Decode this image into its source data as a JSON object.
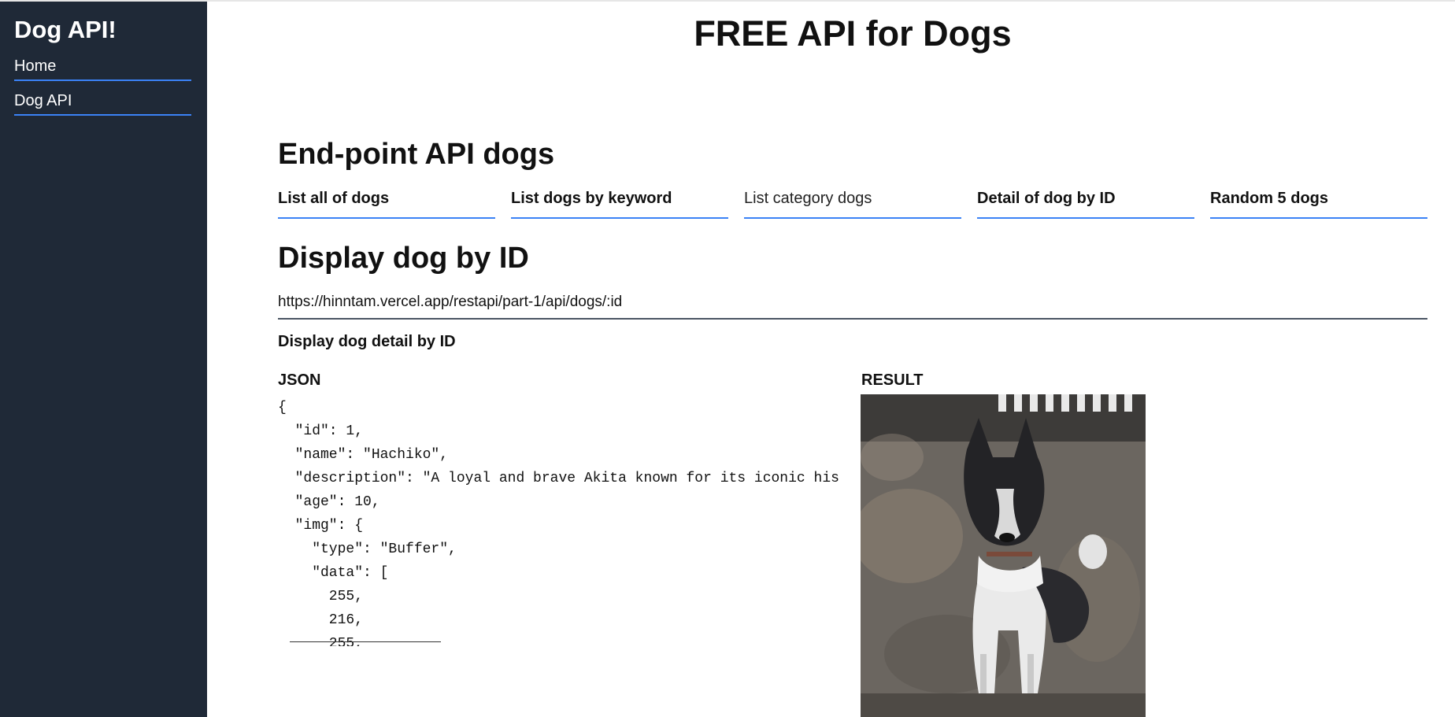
{
  "sidebar": {
    "brand": "Dog API!",
    "items": [
      {
        "label": "Home"
      },
      {
        "label": "Dog API"
      }
    ]
  },
  "main": {
    "title": "FREE API for Dogs",
    "section_title": "End-point API dogs",
    "tabs": [
      {
        "label": "List all of dogs",
        "active": true
      },
      {
        "label": "List dogs by keyword",
        "active": true
      },
      {
        "label": "List category dogs",
        "active": false
      },
      {
        "label": "Detail of dog by ID",
        "active": true
      },
      {
        "label": "Random 5 dogs",
        "active": true
      }
    ],
    "display_title": "Display dog by ID",
    "endpoint": "https://hinntam.vercel.app/restapi/part-1/api/dogs/:id",
    "subheading": "Display dog detail by ID",
    "json_label": "JSON",
    "result_label": "RESULT",
    "json_text": "{\n  \"id\": 1,\n  \"name\": \"Hachiko\",\n  \"description\": \"A loyal and brave Akita known for its iconic his\n  \"age\": 10,\n  \"img\": {\n    \"type\": \"Buffer\",\n    \"data\": [\n      255,\n      216,\n      255,"
  },
  "colors": {
    "sidebar_bg": "#1f2937",
    "accent": "#3b82f6"
  }
}
